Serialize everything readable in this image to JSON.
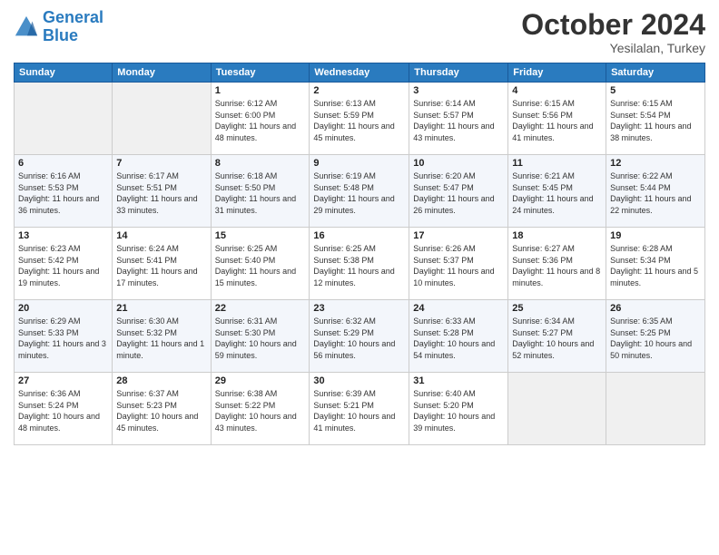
{
  "header": {
    "logo_line1": "General",
    "logo_line2": "Blue",
    "month": "October 2024",
    "location": "Yesilalan, Turkey"
  },
  "days_of_week": [
    "Sunday",
    "Monday",
    "Tuesday",
    "Wednesday",
    "Thursday",
    "Friday",
    "Saturday"
  ],
  "weeks": [
    [
      {
        "num": "",
        "info": ""
      },
      {
        "num": "",
        "info": ""
      },
      {
        "num": "1",
        "info": "Sunrise: 6:12 AM\nSunset: 6:00 PM\nDaylight: 11 hours and 48 minutes."
      },
      {
        "num": "2",
        "info": "Sunrise: 6:13 AM\nSunset: 5:59 PM\nDaylight: 11 hours and 45 minutes."
      },
      {
        "num": "3",
        "info": "Sunrise: 6:14 AM\nSunset: 5:57 PM\nDaylight: 11 hours and 43 minutes."
      },
      {
        "num": "4",
        "info": "Sunrise: 6:15 AM\nSunset: 5:56 PM\nDaylight: 11 hours and 41 minutes."
      },
      {
        "num": "5",
        "info": "Sunrise: 6:15 AM\nSunset: 5:54 PM\nDaylight: 11 hours and 38 minutes."
      }
    ],
    [
      {
        "num": "6",
        "info": "Sunrise: 6:16 AM\nSunset: 5:53 PM\nDaylight: 11 hours and 36 minutes."
      },
      {
        "num": "7",
        "info": "Sunrise: 6:17 AM\nSunset: 5:51 PM\nDaylight: 11 hours and 33 minutes."
      },
      {
        "num": "8",
        "info": "Sunrise: 6:18 AM\nSunset: 5:50 PM\nDaylight: 11 hours and 31 minutes."
      },
      {
        "num": "9",
        "info": "Sunrise: 6:19 AM\nSunset: 5:48 PM\nDaylight: 11 hours and 29 minutes."
      },
      {
        "num": "10",
        "info": "Sunrise: 6:20 AM\nSunset: 5:47 PM\nDaylight: 11 hours and 26 minutes."
      },
      {
        "num": "11",
        "info": "Sunrise: 6:21 AM\nSunset: 5:45 PM\nDaylight: 11 hours and 24 minutes."
      },
      {
        "num": "12",
        "info": "Sunrise: 6:22 AM\nSunset: 5:44 PM\nDaylight: 11 hours and 22 minutes."
      }
    ],
    [
      {
        "num": "13",
        "info": "Sunrise: 6:23 AM\nSunset: 5:42 PM\nDaylight: 11 hours and 19 minutes."
      },
      {
        "num": "14",
        "info": "Sunrise: 6:24 AM\nSunset: 5:41 PM\nDaylight: 11 hours and 17 minutes."
      },
      {
        "num": "15",
        "info": "Sunrise: 6:25 AM\nSunset: 5:40 PM\nDaylight: 11 hours and 15 minutes."
      },
      {
        "num": "16",
        "info": "Sunrise: 6:25 AM\nSunset: 5:38 PM\nDaylight: 11 hours and 12 minutes."
      },
      {
        "num": "17",
        "info": "Sunrise: 6:26 AM\nSunset: 5:37 PM\nDaylight: 11 hours and 10 minutes."
      },
      {
        "num": "18",
        "info": "Sunrise: 6:27 AM\nSunset: 5:36 PM\nDaylight: 11 hours and 8 minutes."
      },
      {
        "num": "19",
        "info": "Sunrise: 6:28 AM\nSunset: 5:34 PM\nDaylight: 11 hours and 5 minutes."
      }
    ],
    [
      {
        "num": "20",
        "info": "Sunrise: 6:29 AM\nSunset: 5:33 PM\nDaylight: 11 hours and 3 minutes."
      },
      {
        "num": "21",
        "info": "Sunrise: 6:30 AM\nSunset: 5:32 PM\nDaylight: 11 hours and 1 minute."
      },
      {
        "num": "22",
        "info": "Sunrise: 6:31 AM\nSunset: 5:30 PM\nDaylight: 10 hours and 59 minutes."
      },
      {
        "num": "23",
        "info": "Sunrise: 6:32 AM\nSunset: 5:29 PM\nDaylight: 10 hours and 56 minutes."
      },
      {
        "num": "24",
        "info": "Sunrise: 6:33 AM\nSunset: 5:28 PM\nDaylight: 10 hours and 54 minutes."
      },
      {
        "num": "25",
        "info": "Sunrise: 6:34 AM\nSunset: 5:27 PM\nDaylight: 10 hours and 52 minutes."
      },
      {
        "num": "26",
        "info": "Sunrise: 6:35 AM\nSunset: 5:25 PM\nDaylight: 10 hours and 50 minutes."
      }
    ],
    [
      {
        "num": "27",
        "info": "Sunrise: 6:36 AM\nSunset: 5:24 PM\nDaylight: 10 hours and 48 minutes."
      },
      {
        "num": "28",
        "info": "Sunrise: 6:37 AM\nSunset: 5:23 PM\nDaylight: 10 hours and 45 minutes."
      },
      {
        "num": "29",
        "info": "Sunrise: 6:38 AM\nSunset: 5:22 PM\nDaylight: 10 hours and 43 minutes."
      },
      {
        "num": "30",
        "info": "Sunrise: 6:39 AM\nSunset: 5:21 PM\nDaylight: 10 hours and 41 minutes."
      },
      {
        "num": "31",
        "info": "Sunrise: 6:40 AM\nSunset: 5:20 PM\nDaylight: 10 hours and 39 minutes."
      },
      {
        "num": "",
        "info": ""
      },
      {
        "num": "",
        "info": ""
      }
    ]
  ]
}
